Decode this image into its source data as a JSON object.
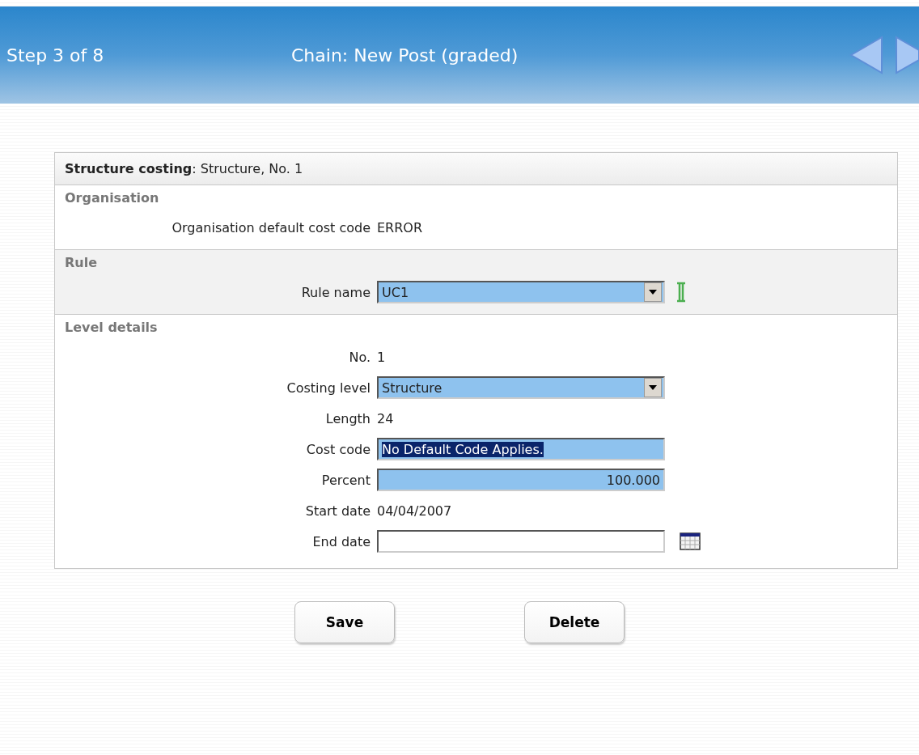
{
  "header": {
    "step": "Step 3 of 8",
    "title": "Chain: New Post (graded)"
  },
  "panel": {
    "title": "**Structure costing**: Structure, No. 1",
    "sections": [
      {
        "title": "Organisation",
        "shaded": false,
        "rows": [
          {
            "kind": "text",
            "label": "Organisation default cost code",
            "value": "ERROR"
          }
        ]
      },
      {
        "title": "Rule",
        "shaded": true,
        "rows": [
          {
            "kind": "lookup-select",
            "label": "Rule name",
            "value": "UC1"
          }
        ]
      },
      {
        "title": "Level details",
        "shaded": false,
        "rows": [
          {
            "kind": "text",
            "label": "No.",
            "value": "1"
          },
          {
            "kind": "select",
            "label": "Costing level",
            "value": "Structure"
          },
          {
            "kind": "text",
            "label": "Length",
            "value": "24"
          },
          {
            "kind": "input",
            "label": "Cost code",
            "value": "No Default Code Applies.",
            "highlighted": true
          },
          {
            "kind": "number-input",
            "label": "Percent",
            "value": "100.000",
            "highlighted": false
          },
          {
            "kind": "text",
            "label": "Start date",
            "value": "04/04/2007"
          },
          {
            "kind": "date-input",
            "label": "End date"
          }
        ]
      }
    ]
  },
  "buttons": [
    "Save",
    "Delete"
  ]
}
